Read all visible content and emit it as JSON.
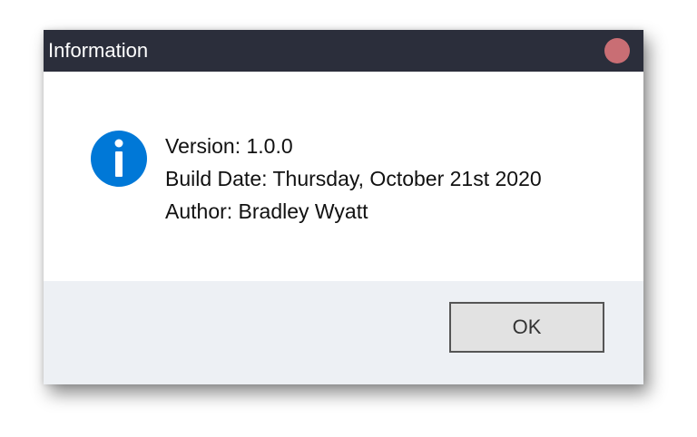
{
  "window": {
    "title": "Information"
  },
  "message": {
    "version": "Version: 1.0.0",
    "build_date": "Build Date: Thursday, October 21st 2020",
    "author": "Author: Bradley Wyatt"
  },
  "buttons": {
    "ok_label": "OK"
  },
  "icons": {
    "info": "info-icon",
    "close": "close-icon"
  },
  "colors": {
    "titlebar": "#2b2e3b",
    "close": "#c96e74",
    "info_icon": "#0078d7",
    "footer": "#edf0f4"
  }
}
